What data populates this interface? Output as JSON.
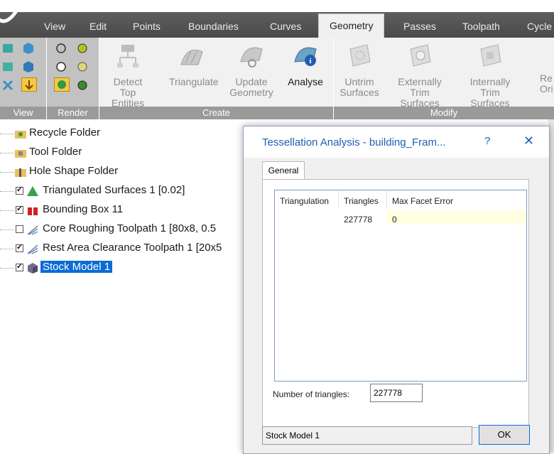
{
  "tabs": [
    "View",
    "Edit",
    "Points",
    "Boundaries",
    "Curves",
    "Geometry",
    "Passes",
    "Toolpath",
    "Cycle"
  ],
  "active_tab": "Geometry",
  "ribbon": {
    "groups": [
      "View",
      "Render",
      "Create",
      "Modify"
    ],
    "create_buttons": [
      {
        "line1": "Detect Top",
        "line2": "Entities"
      },
      {
        "line1": "Triangulate",
        "line2": ""
      },
      {
        "line1": "Update",
        "line2": "Geometry"
      },
      {
        "line1": "Analyse",
        "line2": ""
      }
    ],
    "modify_buttons": [
      {
        "line1": "Untrim",
        "line2": "Surfaces"
      },
      {
        "line1": "Externally",
        "line2": "Trim Surfaces"
      },
      {
        "line1": "Internally",
        "line2": "Trim Surfaces"
      },
      {
        "line1": "Re",
        "line2": "Ori"
      }
    ]
  },
  "tree": [
    {
      "label": "Recycle Folder",
      "checkbox": false,
      "checked": false,
      "icon": "recycle-folder-icon"
    },
    {
      "label": "Tool Folder",
      "checkbox": false,
      "checked": false,
      "icon": "tool-folder-icon"
    },
    {
      "label": "Hole Shape Folder",
      "checkbox": false,
      "checked": false,
      "icon": "hole-folder-icon"
    },
    {
      "label": "Triangulated Surfaces 1 [0.02]",
      "checkbox": true,
      "checked": true,
      "icon": "triangle-icon"
    },
    {
      "label": "Bounding Box 11",
      "checkbox": true,
      "checked": true,
      "icon": "bounding-box-icon"
    },
    {
      "label": "Core Roughing Toolpath 1 [80x8, 0.5",
      "checkbox": true,
      "checked": false,
      "icon": "toolpath-icon"
    },
    {
      "label": "Rest Area Clearance Toolpath 1 [20x5",
      "checkbox": true,
      "checked": true,
      "icon": "toolpath-icon"
    },
    {
      "label": "Stock Model 1",
      "checkbox": true,
      "checked": true,
      "icon": "stock-model-icon",
      "selected": true
    }
  ],
  "dialog": {
    "title": "Tessellation Analysis - building_Fram...",
    "help": "?",
    "close": "✕",
    "tab": "General",
    "columns": [
      "Triangulation",
      "Triangles",
      "Max Facet Error"
    ],
    "rows": [
      {
        "triangulation": "",
        "triangles": "227778",
        "max_facet_error": "0"
      }
    ],
    "num_triangles_label": "Number of triangles:",
    "num_triangles_value": "227778",
    "status": "Stock Model 1",
    "ok": "OK"
  },
  "colors": {
    "selection": "#0a6cd6",
    "dialog_title": "#1f5eb0",
    "row_highlight": "#ffffe1"
  }
}
